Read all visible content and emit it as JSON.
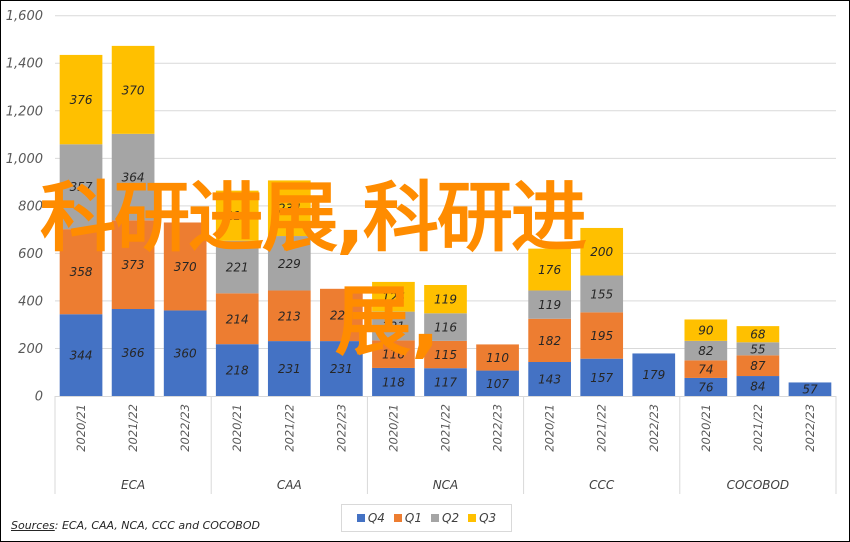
{
  "chart_data": {
    "type": "bar",
    "stacked": true,
    "title": "",
    "xlabel": "",
    "ylabel": "",
    "ylim": [
      0,
      1600
    ],
    "yticks": [
      0,
      200,
      400,
      600,
      800,
      1000,
      1200,
      1400,
      1600
    ],
    "ytick_labels": [
      "0",
      "200",
      "400",
      "600",
      "800",
      "1,000",
      "1,200",
      "1,400",
      "1,600"
    ],
    "grid": true,
    "legend_position": "bottom",
    "groups": [
      {
        "name": "ECA",
        "years": [
          "2020/21",
          "2021/22",
          "2022/23"
        ]
      },
      {
        "name": "CAA",
        "years": [
          "2020/21",
          "2021/22",
          "2022/23"
        ]
      },
      {
        "name": "NCA",
        "years": [
          "2020/21",
          "2021/22",
          "2022/23"
        ]
      },
      {
        "name": "CCC",
        "years": [
          "2020/21",
          "2021/22",
          "2022/23"
        ]
      },
      {
        "name": "COCOBOD",
        "years": [
          "2020/21",
          "2021/22",
          "2022/23"
        ]
      }
    ],
    "categories": [
      "ECA 2020/21",
      "ECA 2021/22",
      "ECA 2022/23",
      "CAA 2020/21",
      "CAA 2021/22",
      "CAA 2022/23",
      "NCA 2020/21",
      "NCA 2021/22",
      "NCA 2022/23",
      "CCC 2020/21",
      "CCC 2021/22",
      "CCC 2022/23",
      "COCOBOD 2020/21",
      "COCOBOD 2021/22",
      "COCOBOD 2022/23"
    ],
    "series": [
      {
        "name": "Q4",
        "color": "#4472c4",
        "values": [
          344,
          366,
          360,
          218,
          231,
          231,
          118,
          117,
          107,
          143,
          157,
          179,
          76,
          84,
          57
        ]
      },
      {
        "name": "Q1",
        "color": "#ed7d31",
        "values": [
          358,
          373,
          370,
          214,
          213,
          220,
          116,
          115,
          110,
          182,
          195,
          null,
          74,
          87,
          null
        ]
      },
      {
        "name": "Q2",
        "color": "#a5a5a5",
        "values": [
          357,
          364,
          null,
          221,
          229,
          null,
          121,
          116,
          null,
          119,
          155,
          null,
          82,
          55,
          null
        ]
      },
      {
        "name": "Q3",
        "color": "#ffc000",
        "values": [
          376,
          370,
          null,
          211,
          234,
          null,
          125,
          119,
          null,
          176,
          200,
          null,
          90,
          68,
          null
        ]
      }
    ]
  },
  "legend": {
    "items": [
      {
        "label": "Q4",
        "color": "#4472c4"
      },
      {
        "label": "Q1",
        "color": "#ed7d31"
      },
      {
        "label": "Q2",
        "color": "#a5a5a5"
      },
      {
        "label": "Q3",
        "color": "#ffc000"
      }
    ]
  },
  "source": {
    "prefix": "Sources",
    "text": ": ECA, CAA, NCA, CCC and COCOBOD"
  },
  "watermark": {
    "line1": "科研进展,科研进",
    "line2": "展,"
  }
}
